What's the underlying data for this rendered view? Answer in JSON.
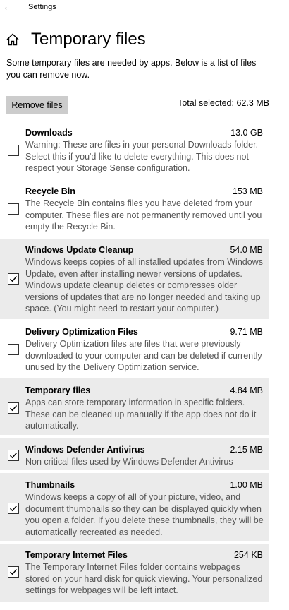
{
  "window": {
    "title": "Settings"
  },
  "page": {
    "title": "Temporary files",
    "description": "Some temporary files are needed by apps. Below is a list of files you can remove now."
  },
  "toolbar": {
    "remove_label": "Remove files",
    "total_selected": "Total selected: 62.3 MB"
  },
  "items": [
    {
      "name": "Downloads",
      "size": "13.0 GB",
      "checked": false,
      "description": "Warning: These are files in your personal Downloads folder. Select this if you'd like to delete everything. This does not respect your Storage Sense configuration."
    },
    {
      "name": "Recycle Bin",
      "size": "153 MB",
      "checked": false,
      "description": "The Recycle Bin contains files you have deleted from your computer. These files are not permanently removed until you empty the Recycle Bin."
    },
    {
      "name": "Windows Update Cleanup",
      "size": "54.0 MB",
      "checked": true,
      "description": "Windows keeps copies of all installed updates from Windows Update, even after installing newer versions of updates. Windows update cleanup deletes or compresses older versions of updates that are no longer needed and taking up space. (You might need to restart your computer.)"
    },
    {
      "name": "Delivery Optimization Files",
      "size": "9.71 MB",
      "checked": false,
      "description": "Delivery Optimization files are files that were previously downloaded to your computer and can be deleted if currently unused by the Delivery Optimization service."
    },
    {
      "name": "Temporary files",
      "size": "4.84 MB",
      "checked": true,
      "description": "Apps can store temporary information in specific folders. These can be cleaned up manually if the app does not do it automatically."
    },
    {
      "name": "Windows Defender Antivirus",
      "size": "2.15 MB",
      "checked": true,
      "description": "Non critical files used by Windows Defender Antivirus"
    },
    {
      "name": "Thumbnails",
      "size": "1.00 MB",
      "checked": true,
      "description": "Windows keeps a copy of all of your picture, video, and document thumbnails so they can be displayed quickly when you open a folder. If you delete these thumbnails, they will be automatically recreated as needed."
    },
    {
      "name": "Temporary Internet Files",
      "size": "254 KB",
      "checked": true,
      "description": "The Temporary Internet Files folder contains webpages stored on your hard disk for quick viewing. Your personalized settings for webpages will be left intact."
    }
  ],
  "icons": {
    "back": "back-arrow-icon",
    "home": "home-icon",
    "check": "checkmark-icon"
  },
  "colors": {
    "selected_row_bg": "#ebebeb",
    "button_bg": "#cccccc",
    "description_text": "#555555"
  }
}
